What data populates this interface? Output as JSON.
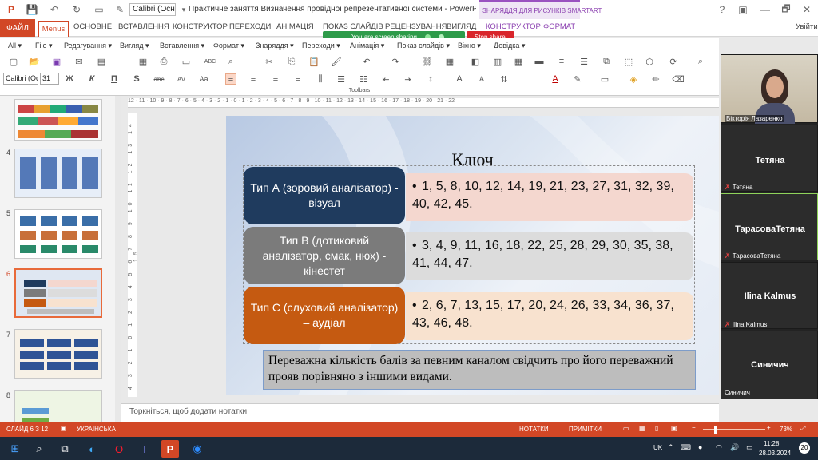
{
  "window": {
    "font_box": "Calibri (Осн",
    "doc_title": "Практичне заняття Визначення провідної репрезентативної системи - PowerPoint (не вдал...",
    "context_tab": "ЗНАРЯДДЯ ДЛЯ РИСУНКІВ SMARTART",
    "controls": [
      "?",
      "▣",
      "—",
      "🗗",
      "✕"
    ]
  },
  "tabs": {
    "file": "ФАЙЛ",
    "menus": "Menus",
    "items": [
      "ОСНОВНЕ",
      "ВСТАВЛЕННЯ",
      "КОНСТРУКТОР",
      "ПЕРЕХОДИ",
      "АНІМАЦІЯ",
      "ПОКАЗ СЛАЙДІВ",
      "РЕЦЕНЗУВАННЯ",
      "ВИГЛЯД",
      "КОНСТРУКТОР",
      "ФОРМАТ"
    ],
    "user": "Увійти"
  },
  "sharing": {
    "text": "You are screen sharing",
    "stop": "Stop share"
  },
  "menus": [
    "All ▾",
    "File ▾",
    "Редагування ▾",
    "Вигляд ▾",
    "Вставлення ▾",
    "Формат ▾",
    "Знаряддя ▾",
    "Переходи ▾",
    "Анімація ▾",
    "Показ слайдів ▾",
    "Вікно ▾",
    "Довідка ▾"
  ],
  "toolbar": {
    "font": "Calibri (Ос",
    "size": "31",
    "label": "Toolbars"
  },
  "thumbs": [
    {
      "num": ""
    },
    {
      "num": "4"
    },
    {
      "num": "5"
    },
    {
      "num": "6"
    },
    {
      "num": "7"
    },
    {
      "num": "8"
    }
  ],
  "ruler_top": "12 · 11 · 10 · 9 · 8 · 7 · 6 · 5 · 4 · 3 · 2 · 1 · 0 · 1 · 2 · 3 · 4 · 5 · 6 · 7 · 8 · 9 · 10 · 11 · 12 · 13 · 14 · 15 · 16 · 17 · 18 · 19 · 20 · 21 · 22",
  "ruler_left": "4 3 2 1 0 1 2 3 4 5 6 7 8 9 10 11 12 13 14 15",
  "slide": {
    "title": "Ключ",
    "rows": [
      {
        "label": "Тип А (зоровий аналізатор) - візуал",
        "detail": "1, 5, 8, 10, 12, 14, 19, 21, 23, 27, 31, 32, 39, 40, 42, 45.",
        "color": "#1f3b5e",
        "detail_bg": "#f4d7cf"
      },
      {
        "label": "Тип В (дотиковий аналізатор, смак, нюх) - кінестет",
        "detail": "3, 4, 9, 11, 16, 18, 22, 25, 28, 29, 30, 35, 38, 41, 44, 47.",
        "color": "#7b7b7b",
        "detail_bg": "#dcdcdc"
      },
      {
        "label": "Тип С (слуховий аналізатор) – аудіал",
        "detail": "2, 6, 7, 13, 15, 17, 20, 24, 26, 33, 34, 36, 37, 43, 46, 48.",
        "color": "#c55a11",
        "detail_bg": "#f8e2cf"
      }
    ],
    "note": "Переважна кількість балів за певним каналом свідчить про його переважний прояв порівняно з іншими видами."
  },
  "notes_placeholder": "Торкніться, щоб додати нотатки",
  "status": {
    "slide": "СЛАЙД 6 З 12",
    "lang": "УКРАЇНСЬКА",
    "notes": "НОТАТКИ",
    "comments": "ПРИМІТКИ",
    "zoom": "73%"
  },
  "participants": [
    {
      "name": "Вікторія Лазаренко",
      "label": "Вікторія Лазаренко",
      "video": true
    },
    {
      "name": "Тетяна",
      "label": "Тетяна",
      "video": false
    },
    {
      "name": "ТарасоваТетяна",
      "label": "ТарасоваТетяна",
      "video": false
    },
    {
      "name": "Ilina Kalmus",
      "label": "Ilina Kalmus",
      "video": false
    },
    {
      "name": "Синичич",
      "label": "Синичич",
      "video": false
    }
  ],
  "taskbar": {
    "lang": "UK",
    "time": "11:28",
    "date": "28.03.2024",
    "notif": "20"
  }
}
